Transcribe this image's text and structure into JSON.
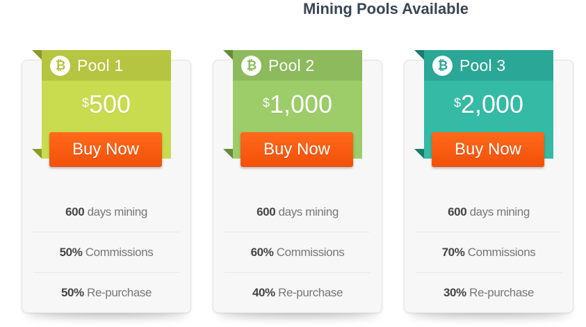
{
  "page": {
    "title": "Mining Pools Available"
  },
  "pools": [
    {
      "name": "Pool 1",
      "currency_symbol": "$",
      "price": "500",
      "buy_label": "Buy Now",
      "icon": "bitcoin-icon",
      "colors": {
        "top": "#b5c541",
        "body": "#c9db4f",
        "fold": "#8b9a2a",
        "coin": "#b5c541"
      },
      "features": [
        {
          "value": "600",
          "label": "days mining"
        },
        {
          "value": "50%",
          "label": "Commissions"
        },
        {
          "value": "50%",
          "label": "Re-purchase"
        }
      ]
    },
    {
      "name": "Pool 2",
      "currency_symbol": "$",
      "price": "1,000",
      "buy_label": "Buy Now",
      "icon": "bitcoin-icon",
      "colors": {
        "top": "#8dba5d",
        "body": "#9dcd69",
        "fold": "#658c3c",
        "coin": "#8dba5d"
      },
      "features": [
        {
          "value": "600",
          "label": "days mining"
        },
        {
          "value": "60%",
          "label": "Commissions"
        },
        {
          "value": "40%",
          "label": "Re-purchase"
        }
      ]
    },
    {
      "name": "Pool 3",
      "currency_symbol": "$",
      "price": "2,000",
      "buy_label": "Buy Now",
      "icon": "bitcoin-icon",
      "colors": {
        "top": "#2aa796",
        "body": "#35baa6",
        "fold": "#1a7a6c",
        "coin": "#2aa796"
      },
      "features": [
        {
          "value": "600",
          "label": "days mining"
        },
        {
          "value": "70%",
          "label": "Commissions"
        },
        {
          "value": "30%",
          "label": "Re-purchase"
        }
      ]
    }
  ]
}
